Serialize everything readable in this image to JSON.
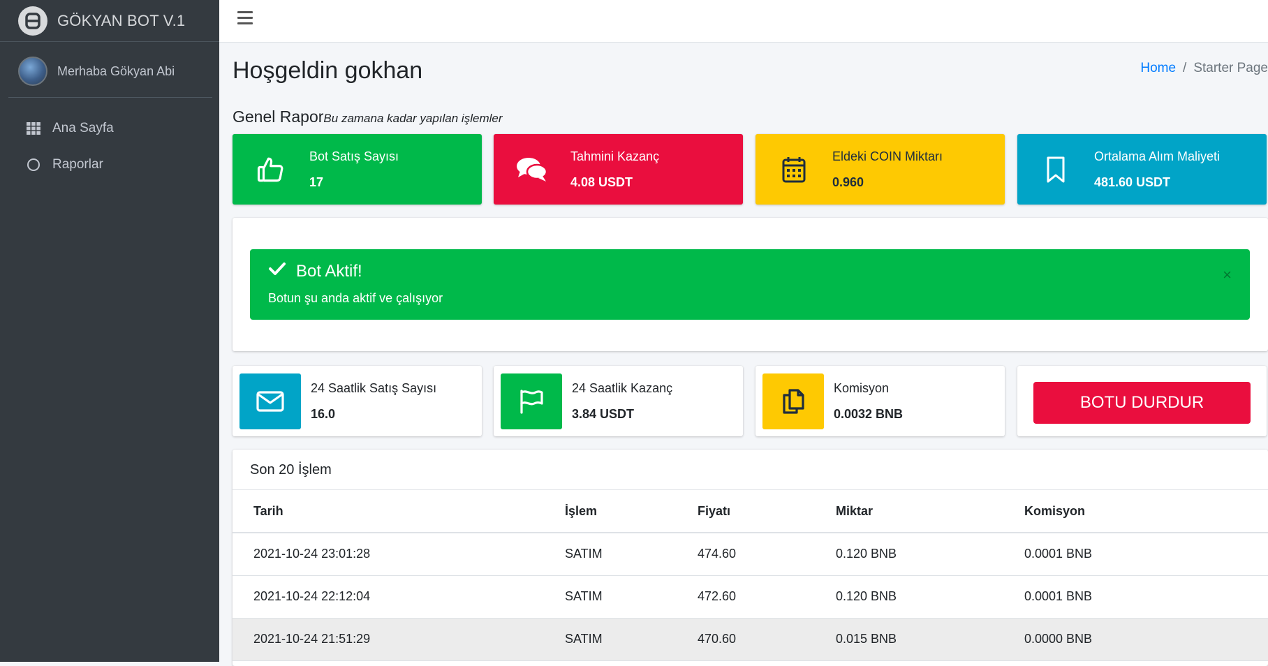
{
  "brand": {
    "title": "GÖKYAN BOT V.1"
  },
  "user": {
    "greeting": "Merhaba Gökyan Abi"
  },
  "sidebar": {
    "items": [
      {
        "label": "Ana Sayfa",
        "icon": "grid-icon"
      },
      {
        "label": "Raporlar",
        "icon": "circle-icon"
      }
    ]
  },
  "page": {
    "title": "Hoşgeldin gokhan"
  },
  "breadcrumb": {
    "home": "Home",
    "separator": "/",
    "current": "Starter Page"
  },
  "report": {
    "title": "Genel Rapor",
    "subtitle": "Bu zamana kadar yapılan işlemler"
  },
  "stats": [
    {
      "label": "Bot Satış Sayısı",
      "value": "17",
      "icon": "thumbs-up-icon",
      "color": "#00b94a"
    },
    {
      "label": "Tahmini Kazanç",
      "value": "4.08 USDT",
      "icon": "comments-icon",
      "color": "#ea0e3e"
    },
    {
      "label": "Eldeki COIN Miktarı",
      "value": "0.960",
      "icon": "calendar-icon",
      "color": "#fec902"
    },
    {
      "label": "Ortalama Alım Maliyeti",
      "value": "481.60 USDT",
      "icon": "bookmark-icon",
      "color": "#01a4c7"
    }
  ],
  "alert": {
    "title": "Bot Aktif!",
    "text": "Botun şu anda aktif ve çalışıyor",
    "close": "×"
  },
  "daily": [
    {
      "label": "24 Saatlik Satış Sayısı",
      "value": "16.0",
      "icon": "envelope-icon",
      "color": "#01a4c7"
    },
    {
      "label": "24 Saatlik Kazanç",
      "value": "3.84 USDT",
      "icon": "flag-icon",
      "color": "#00b94a"
    },
    {
      "label": "Komisyon",
      "value": "0.0032 BNB",
      "icon": "copy-icon",
      "color": "#fec902"
    }
  ],
  "stop_button": {
    "label": "BOTU DURDUR"
  },
  "transactions": {
    "title": "Son 20 İşlem",
    "columns": [
      "Tarih",
      "İşlem",
      "Fiyatı",
      "Miktar",
      "Komisyon"
    ],
    "rows": [
      [
        "2021-10-24 23:01:28",
        "SATIM",
        "474.60",
        "0.120 BNB",
        "0.0001 BNB"
      ],
      [
        "2021-10-24 22:12:04",
        "SATIM",
        "472.60",
        "0.120 BNB",
        "0.0001 BNB"
      ],
      [
        "2021-10-24 21:51:29",
        "SATIM",
        "470.60",
        "0.015 BNB",
        "0.0000 BNB"
      ]
    ]
  }
}
